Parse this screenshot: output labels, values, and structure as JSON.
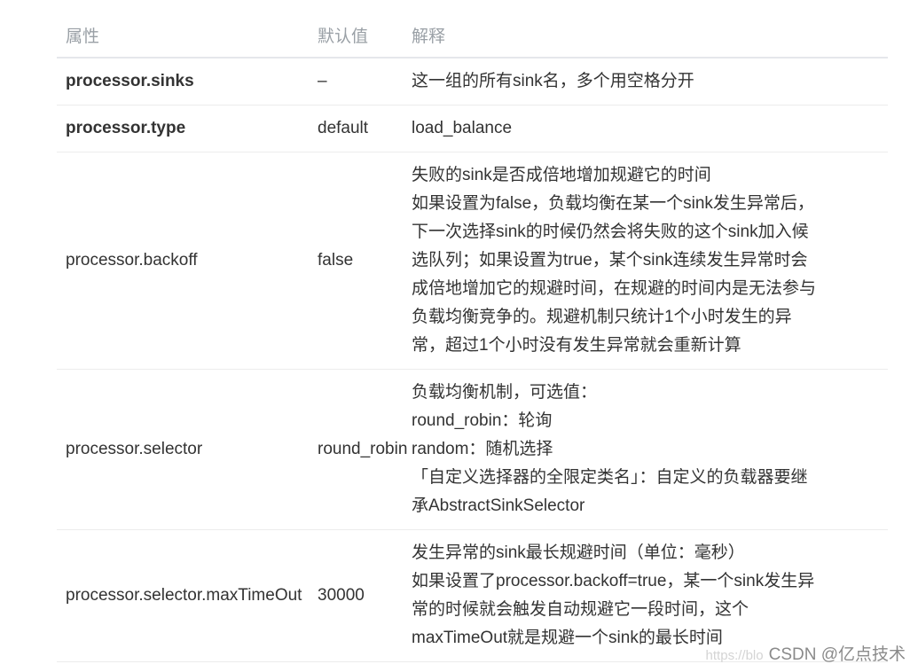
{
  "header": {
    "col_property": "属性",
    "col_default": "默认值",
    "col_description": "解释"
  },
  "rows": [
    {
      "property": "processor.sinks",
      "default": "–",
      "description": [
        "这一组的所有sink名，多个用空格分开"
      ]
    },
    {
      "property": "processor.type",
      "default": "default",
      "description": [
        "load_balance"
      ]
    },
    {
      "property": "processor.backoff",
      "default": "false",
      "description": [
        "失败的sink是否成倍地增加规避它的时间",
        "如果设置为false，负载均衡在某一个sink发生异常后，",
        "下一次选择sink的时候仍然会将失败的这个sink加入候",
        "选队列；如果设置为true，某个sink连续发生异常时会",
        "成倍地增加它的规避时间，在规避的时间内是无法参与",
        "负载均衡竞争的。规避机制只统计1个小时发生的异",
        "常，超过1个小时没有发生异常就会重新计算"
      ]
    },
    {
      "property": "processor.selector",
      "default": "round_robin",
      "description": [
        "负载均衡机制，可选值：",
        "round_robin：轮询",
        "random：随机选择",
        "「自定义选择器的全限定类名」：自定义的负载器要继",
        "承AbstractSinkSelector"
      ]
    },
    {
      "property": "processor.selector.maxTimeOut",
      "default": "30000",
      "description": [
        "发生异常的sink最长规避时间（单位：毫秒）",
        "如果设置了processor.backoff=true，某一个sink发生异",
        "常的时候就会触发自动规避它一段时间，这个",
        "maxTimeOut就是规避一个sink的最长时间"
      ]
    }
  ],
  "watermark": {
    "url": "https://blo",
    "brand": "CSDN @亿点技术"
  }
}
